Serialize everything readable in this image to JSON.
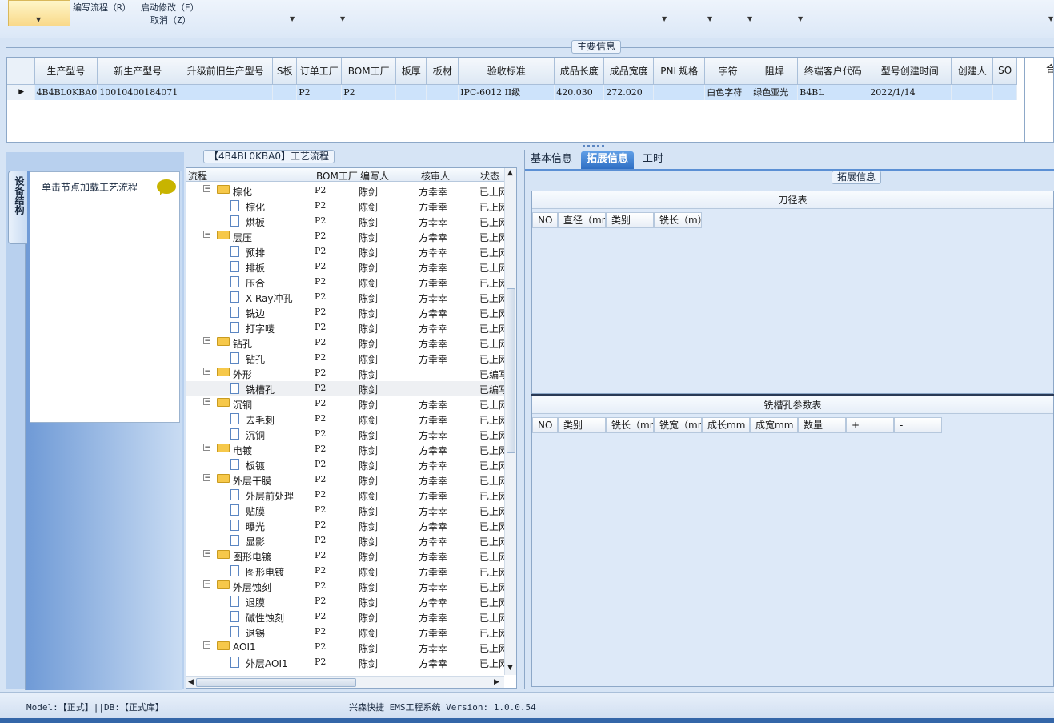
{
  "toolbar": {
    "menu1": "编写流程（R）",
    "menu2": "启动修改（E）",
    "menu3": "取消（Z）"
  },
  "main_info": {
    "group_title": "主要信息",
    "columns": [
      "生产型号",
      "新生产型号",
      "升级前旧生产型号",
      "S板",
      "订单工厂",
      "BOM工厂",
      "板厚",
      "板材",
      "验收标准",
      "成品长度",
      "成品宽度",
      "PNL规格",
      "字符",
      "阻焊",
      "终端客户代码",
      "型号创建时间",
      "创建人",
      "SO"
    ],
    "row": [
      "4B4BL0KBA0",
      "10010400184071",
      "",
      "",
      "P2",
      "P2",
      "",
      "",
      "IPC-6012 II级",
      "420.030",
      "272.020",
      "",
      "白色字符",
      "绿色亚光",
      "B4BL",
      "2022/1/14",
      "",
      ""
    ],
    "side_label": "合"
  },
  "nav": {
    "vertical_tab": "设备结构",
    "hint": "单击节点加载工艺流程"
  },
  "process": {
    "group_title": "【4B4BL0KBA0】工艺流程",
    "headers": [
      "流程",
      "BOM工厂",
      "编写人",
      "核审人",
      "状态"
    ],
    "rows": [
      {
        "level": 0,
        "name": "棕化",
        "bom": "P2",
        "writer": "陈剑",
        "reviewer": "方幸幸",
        "status": "已上网"
      },
      {
        "level": 1,
        "name": "棕化",
        "bom": "P2",
        "writer": "陈剑",
        "reviewer": "方幸幸",
        "status": "已上网"
      },
      {
        "level": 1,
        "name": "烘板",
        "bom": "P2",
        "writer": "陈剑",
        "reviewer": "方幸幸",
        "status": "已上网"
      },
      {
        "level": 0,
        "name": "层压",
        "bom": "P2",
        "writer": "陈剑",
        "reviewer": "方幸幸",
        "status": "已上网"
      },
      {
        "level": 1,
        "name": "预排",
        "bom": "P2",
        "writer": "陈剑",
        "reviewer": "方幸幸",
        "status": "已上网"
      },
      {
        "level": 1,
        "name": "排板",
        "bom": "P2",
        "writer": "陈剑",
        "reviewer": "方幸幸",
        "status": "已上网"
      },
      {
        "level": 1,
        "name": "压合",
        "bom": "P2",
        "writer": "陈剑",
        "reviewer": "方幸幸",
        "status": "已上网"
      },
      {
        "level": 1,
        "name": "X-Ray冲孔",
        "bom": "P2",
        "writer": "陈剑",
        "reviewer": "方幸幸",
        "status": "已上网"
      },
      {
        "level": 1,
        "name": "铣边",
        "bom": "P2",
        "writer": "陈剑",
        "reviewer": "方幸幸",
        "status": "已上网"
      },
      {
        "level": 1,
        "name": "打字唛",
        "bom": "P2",
        "writer": "陈剑",
        "reviewer": "方幸幸",
        "status": "已上网"
      },
      {
        "level": 0,
        "name": "钻孔",
        "bom": "P2",
        "writer": "陈剑",
        "reviewer": "方幸幸",
        "status": "已上网"
      },
      {
        "level": 1,
        "name": "钻孔",
        "bom": "P2",
        "writer": "陈剑",
        "reviewer": "方幸幸",
        "status": "已上网"
      },
      {
        "level": 0,
        "name": "外形",
        "bom": "P2",
        "writer": "陈剑",
        "reviewer": "",
        "status": "已编写"
      },
      {
        "level": 1,
        "name": "铣槽孔",
        "bom": "P2",
        "writer": "陈剑",
        "reviewer": "",
        "status": "已编写",
        "selected": true
      },
      {
        "level": 0,
        "name": "沉铜",
        "bom": "P2",
        "writer": "陈剑",
        "reviewer": "方幸幸",
        "status": "已上网"
      },
      {
        "level": 1,
        "name": "去毛刺",
        "bom": "P2",
        "writer": "陈剑",
        "reviewer": "方幸幸",
        "status": "已上网"
      },
      {
        "level": 1,
        "name": "沉铜",
        "bom": "P2",
        "writer": "陈剑",
        "reviewer": "方幸幸",
        "status": "已上网"
      },
      {
        "level": 0,
        "name": "电镀",
        "bom": "P2",
        "writer": "陈剑",
        "reviewer": "方幸幸",
        "status": "已上网"
      },
      {
        "level": 1,
        "name": "板镀",
        "bom": "P2",
        "writer": "陈剑",
        "reviewer": "方幸幸",
        "status": "已上网"
      },
      {
        "level": 0,
        "name": "外层干膜",
        "bom": "P2",
        "writer": "陈剑",
        "reviewer": "方幸幸",
        "status": "已上网"
      },
      {
        "level": 1,
        "name": "外层前处理",
        "bom": "P2",
        "writer": "陈剑",
        "reviewer": "方幸幸",
        "status": "已上网"
      },
      {
        "level": 1,
        "name": "贴膜",
        "bom": "P2",
        "writer": "陈剑",
        "reviewer": "方幸幸",
        "status": "已上网"
      },
      {
        "level": 1,
        "name": "曝光",
        "bom": "P2",
        "writer": "陈剑",
        "reviewer": "方幸幸",
        "status": "已上网"
      },
      {
        "level": 1,
        "name": "显影",
        "bom": "P2",
        "writer": "陈剑",
        "reviewer": "方幸幸",
        "status": "已上网"
      },
      {
        "level": 0,
        "name": "图形电镀",
        "bom": "P2",
        "writer": "陈剑",
        "reviewer": "方幸幸",
        "status": "已上网"
      },
      {
        "level": 1,
        "name": "图形电镀",
        "bom": "P2",
        "writer": "陈剑",
        "reviewer": "方幸幸",
        "status": "已上网"
      },
      {
        "level": 0,
        "name": "外层蚀刻",
        "bom": "P2",
        "writer": "陈剑",
        "reviewer": "方幸幸",
        "status": "已上网"
      },
      {
        "level": 1,
        "name": "退膜",
        "bom": "P2",
        "writer": "陈剑",
        "reviewer": "方幸幸",
        "status": "已上网"
      },
      {
        "level": 1,
        "name": "碱性蚀刻",
        "bom": "P2",
        "writer": "陈剑",
        "reviewer": "方幸幸",
        "status": "已上网"
      },
      {
        "level": 1,
        "name": "退锡",
        "bom": "P2",
        "writer": "陈剑",
        "reviewer": "方幸幸",
        "status": "已上网"
      },
      {
        "level": 0,
        "name": "AOI1",
        "bom": "P2",
        "writer": "陈剑",
        "reviewer": "方幸幸",
        "status": "已上网"
      },
      {
        "level": 1,
        "name": "外层AOI1",
        "bom": "P2",
        "writer": "陈剑",
        "reviewer": "方幸幸",
        "status": "已上网"
      }
    ]
  },
  "tabs": {
    "basic": "基本信息",
    "extended": "拓展信息",
    "worktime": "工时"
  },
  "extended": {
    "group_title": "拓展信息",
    "tool_table": {
      "title": "刀径表",
      "columns": [
        "NO",
        "直径（mm）",
        "类别",
        "铣长（m）"
      ]
    },
    "slot_table": {
      "title": "铣槽孔参数表",
      "columns": [
        "NO",
        "类别",
        "铣长（mm）",
        "铣宽（mm）",
        "成长mm",
        "成宽mm",
        "数量",
        "+",
        "-"
      ]
    }
  },
  "status": {
    "model": "Model:【正式】||DB:【正式库】",
    "system": "兴森快捷 EMS工程系统 Version: 1.0.0.54"
  }
}
